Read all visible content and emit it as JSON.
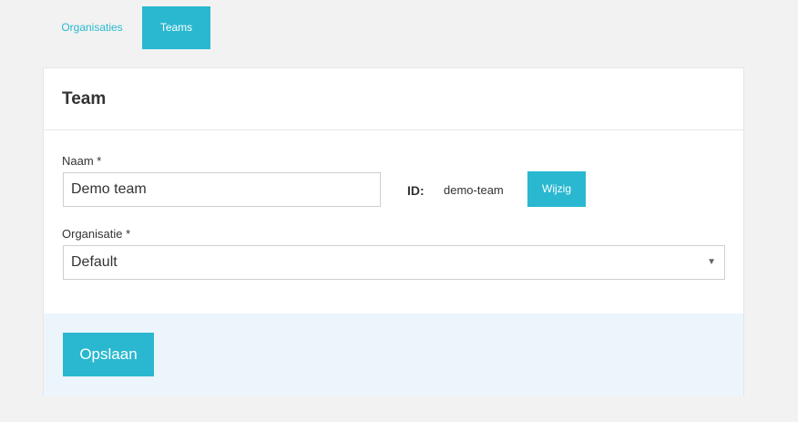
{
  "tabs": [
    {
      "label": "Organisaties",
      "active": false
    },
    {
      "label": "Teams",
      "active": true
    }
  ],
  "card": {
    "title": "Team",
    "name_field": {
      "label": "Naam *",
      "value": "Demo team"
    },
    "id_field": {
      "label": "ID:",
      "value": "demo-team",
      "change_button": "Wijzig"
    },
    "organisation_field": {
      "label": "Organisatie *",
      "selected": "Default"
    },
    "save_button": "Opslaan"
  },
  "colors": {
    "accent": "#29b8d0",
    "footer_background": "#edf5fc",
    "page_background": "#f2f2f2"
  },
  "icons": {
    "select_arrow": "caret-down-icon"
  }
}
